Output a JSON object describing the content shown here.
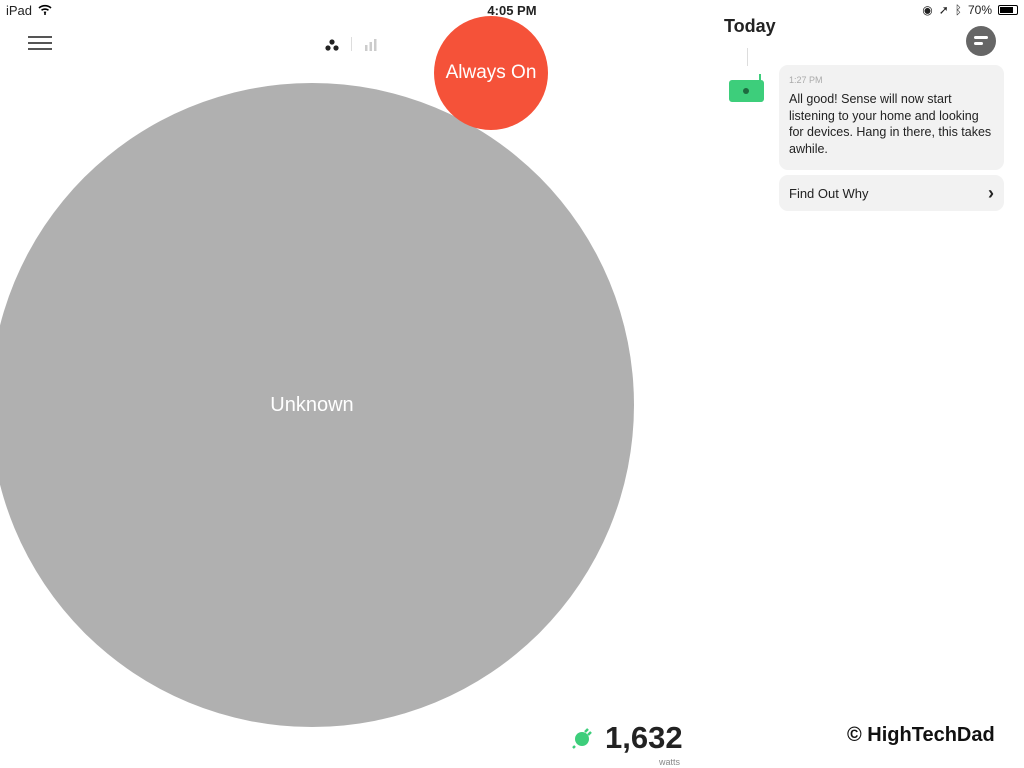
{
  "status_bar": {
    "device": "iPad",
    "time": "4:05 PM",
    "battery": "70%",
    "battery_level": 0.7
  },
  "toolbar": {
    "view_bubbles": "bubbles-icon",
    "view_bars": "bar-chart-icon"
  },
  "bubbles": [
    {
      "label": "Unknown",
      "color": "#b0b0b0"
    },
    {
      "label": "Always On",
      "color": "#f55239"
    }
  ],
  "feed": {
    "title": "Today",
    "message": {
      "time": "1:27 PM",
      "text": "All good! Sense will now start listening to your home and looking for devices. Hang in there, this takes awhile."
    },
    "link": "Find Out Why"
  },
  "power": {
    "value": "1,632",
    "unit": "watts",
    "color": "#3dce7b"
  },
  "watermark": "© HighTechDad"
}
